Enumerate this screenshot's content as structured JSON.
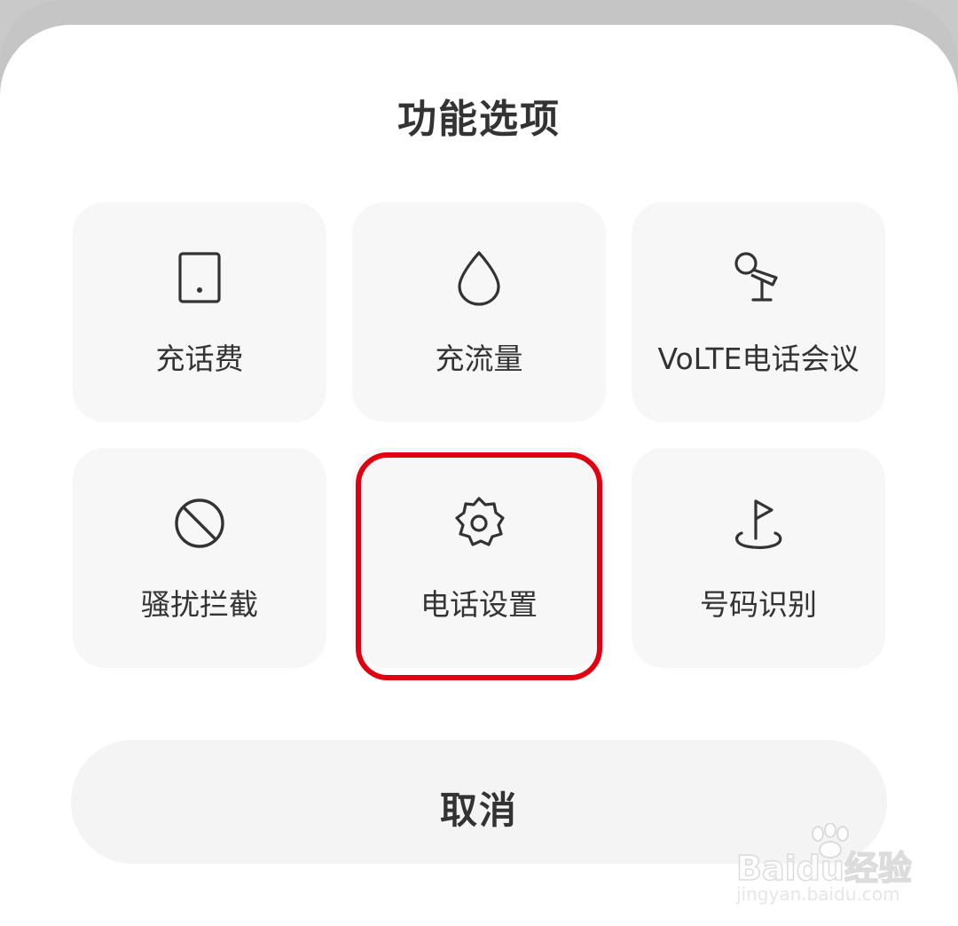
{
  "dialog": {
    "title": "功能选项",
    "cancel_label": "取消"
  },
  "options": [
    {
      "label": "充话费",
      "icon": "tablet-icon"
    },
    {
      "label": "充流量",
      "icon": "water-drop-icon"
    },
    {
      "label": "VoLTE电话会议",
      "icon": "microphone-icon"
    },
    {
      "label": "骚扰拦截",
      "icon": "block-icon"
    },
    {
      "label": "电话设置",
      "icon": "gear-icon",
      "highlighted": true
    },
    {
      "label": "号码识别",
      "icon": "flag-pin-icon"
    }
  ],
  "watermark": {
    "brand": "Baidu经验",
    "site": "jingyan.baidu.com"
  },
  "colors": {
    "highlight": "#e00012",
    "tile_bg": "#f7f7f7",
    "text": "#333333"
  }
}
